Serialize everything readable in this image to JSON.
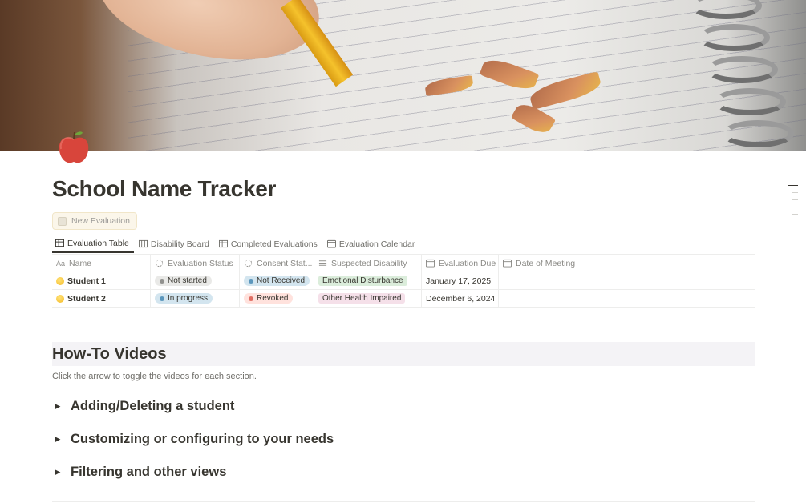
{
  "page": {
    "title": "School Name Tracker",
    "icon": "apple-icon"
  },
  "actions": {
    "new_evaluation_label": "New Evaluation"
  },
  "tabs": [
    {
      "label": "Evaluation Table",
      "icon": "table-icon"
    },
    {
      "label": "Disability Board",
      "icon": "board-icon"
    },
    {
      "label": "Completed Evaluations",
      "icon": "table-icon"
    },
    {
      "label": "Evaluation Calendar",
      "icon": "calendar-icon"
    }
  ],
  "table": {
    "columns": [
      {
        "label": "Name",
        "icon": "text-prop-icon"
      },
      {
        "label": "Evaluation Status",
        "icon": "status-icon"
      },
      {
        "label": "Consent Stat...",
        "icon": "status-icon"
      },
      {
        "label": "Suspected Disability",
        "icon": "list-icon"
      },
      {
        "label": "Evaluation Due",
        "icon": "calendar-icon"
      },
      {
        "label": "Date of Meeting",
        "icon": "calendar-icon"
      }
    ],
    "rows": [
      {
        "name": "Student 1",
        "status": "Not started",
        "consent": "Not Received",
        "disability": "Emotional Disturbance",
        "due": "January 17, 2025",
        "meeting": ""
      },
      {
        "name": "Student 2",
        "status": "In progress",
        "consent": "Revoked",
        "disability": "Other Health Impaired",
        "due": "December 6, 2024",
        "meeting": ""
      }
    ]
  },
  "colors": {
    "not_started_bg": "#e9e9e7",
    "not_started_dot": "#91918e",
    "in_progress_bg": "#d3e5ef",
    "in_progress_dot": "#5b97bd",
    "not_received_bg": "#d3e5ef",
    "not_received_dot": "#5b97bd",
    "revoked_bg": "#ffe2dd",
    "revoked_dot": "#e16f64",
    "emotional_bg": "#dbeddb",
    "health_bg": "#f5e0e9"
  },
  "howto": {
    "heading": "How-To Videos",
    "description": "Click the arrow to toggle the videos for each section.",
    "toggles": [
      "Adding/Deleting a student",
      "Customizing or configuring to your needs",
      "Filtering and other views"
    ]
  }
}
